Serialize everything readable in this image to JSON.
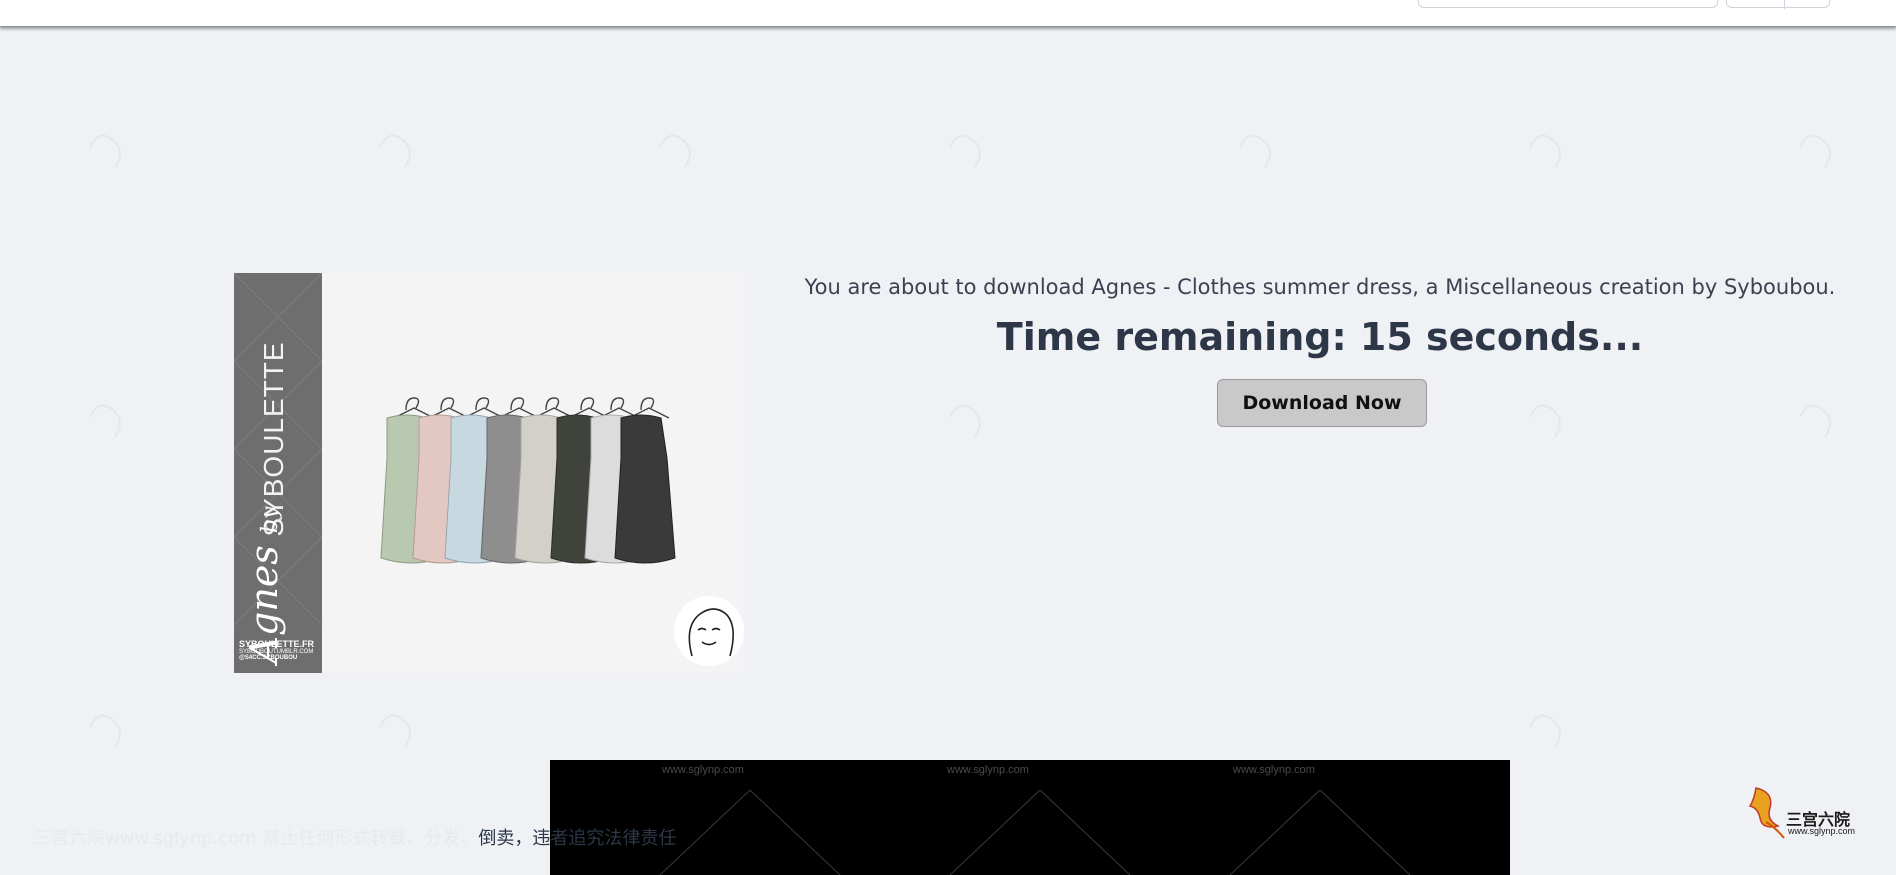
{
  "download": {
    "message": "You are about to download Agnes - Clothes summer dress, a Miscellaneous creation by Syboubou.",
    "timer": "Time remaining: 15 seconds...",
    "button_label": "Download Now"
  },
  "image": {
    "brand": "SYBOULETTE",
    "script_title": "Agnes",
    "script_by": "by",
    "footer_site": "SYBOULETTE.FR",
    "footer_tumblr": "SYBOUBOUTUMBLR.COM",
    "footer_handle": "@S4CC.SYBOUBOU"
  },
  "watermark": {
    "url": "www.sglynp.com",
    "notice_dim": "三宫六院www.sglynp.com 禁止任何形式转载、分发、",
    "notice_main": "倒卖，违者追究法律责任"
  },
  "logo": {
    "text": "三宫六院",
    "url": "www.sglynp.com"
  },
  "colors": {
    "background": "#eff1f4",
    "text_dark": "#2d3748",
    "button_bg": "#c9c9c9"
  }
}
